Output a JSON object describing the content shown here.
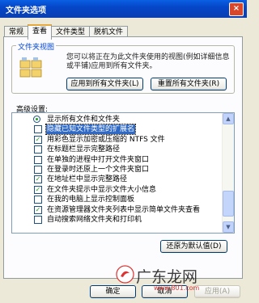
{
  "window": {
    "title": "文件夹选项",
    "close_glyph": "×"
  },
  "tabs": [
    {
      "label": "常规"
    },
    {
      "label": "查看"
    },
    {
      "label": "文件类型"
    },
    {
      "label": "脱机文件"
    }
  ],
  "folder_views": {
    "title": "文件夹视图",
    "description": "您可以将正在为此文件夹使用的视图(例如详细信息或平铺)应用到所有文件夹。",
    "apply_all_label": "应用到所有文件夹(L)",
    "reset_all_label": "重置所有文件夹(R)"
  },
  "advanced": {
    "label": "高级设置:",
    "items": [
      {
        "type": "radio",
        "checked": true,
        "label": "显示所有文件和文件夹"
      },
      {
        "type": "checkbox",
        "checked": false,
        "label": "隐藏已知文件类型的扩展名",
        "selected": true
      },
      {
        "type": "checkbox",
        "checked": true,
        "label": "用彩色显示加密或压缩的 NTFS 文件"
      },
      {
        "type": "checkbox",
        "checked": false,
        "label": "在标题栏显示完整路径"
      },
      {
        "type": "checkbox",
        "checked": false,
        "label": "在单独的进程中打开文件夹窗口"
      },
      {
        "type": "checkbox",
        "checked": false,
        "label": "在登录时还原上一个文件夹窗口"
      },
      {
        "type": "checkbox",
        "checked": true,
        "label": "在地址栏中显示完整路径"
      },
      {
        "type": "checkbox",
        "checked": true,
        "label": "在文件夹提示中显示文件大小信息"
      },
      {
        "type": "checkbox",
        "checked": false,
        "label": "在我的电脑上显示控制面板"
      },
      {
        "type": "checkbox",
        "checked": true,
        "label": "在资源管理器文件夹列表中显示简单文件夹查看"
      },
      {
        "type": "checkbox",
        "checked": false,
        "label": "自动搜索网络文件夹和打印机"
      }
    ],
    "scroll_up_glyph": "▲",
    "scroll_down_glyph": "▼"
  },
  "restore_defaults_label": "还原为默认值(D)",
  "footer": {
    "ok_label": "确定",
    "cancel_label": "取消",
    "apply_label": "应用(A)"
  },
  "watermark": {
    "text": "广东龙网",
    "url": "www.801.com"
  },
  "colors": {
    "title_bar": "#0546c8",
    "selection": "#316ac5",
    "group_title": "#0046d5"
  }
}
